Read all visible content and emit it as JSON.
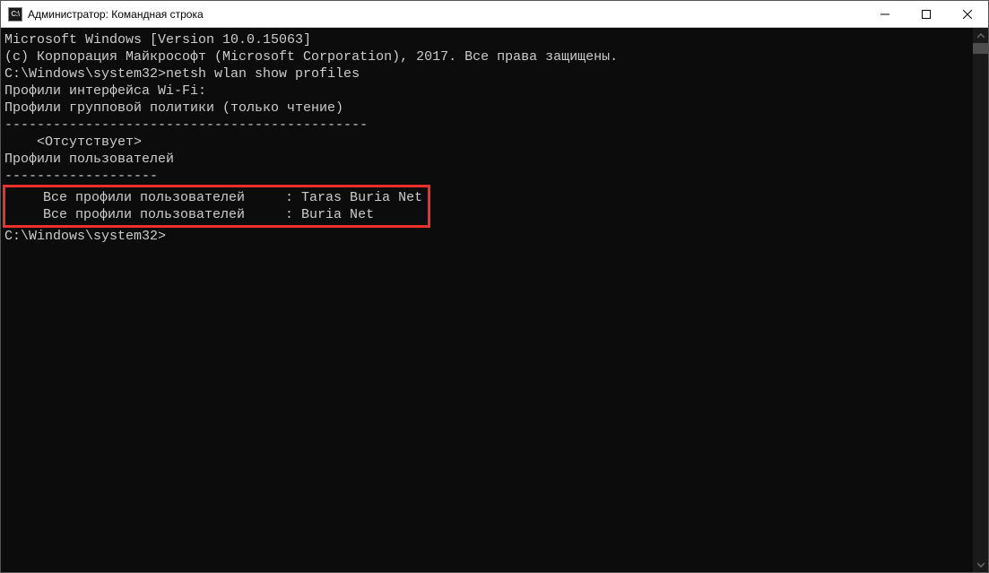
{
  "window": {
    "title": "Администратор: Командная строка"
  },
  "terminal": {
    "line1": "Microsoft Windows [Version 10.0.15063]",
    "line2": "(c) Корпорация Майкрософт (Microsoft Corporation), 2017. Все права защищены.",
    "blank": "",
    "prompt1": "C:\\Windows\\system32>netsh wlan show profiles",
    "blank2": "",
    "header": "Профили интерфейса Wi-Fi:",
    "blank3": "",
    "group_header": "Профили групповой политики (только чтение)",
    "group_sep": "---------------------------------------------",
    "group_none": "    <Отсутствует>",
    "blank4": "",
    "user_header": "Профили пользователей",
    "user_sep": "-------------------",
    "profile1": "    Все профили пользователей     : Taras Buria Net",
    "profile2": "    Все профили пользователей     : Buria Net",
    "box_pad": "                                                   ",
    "blank5": "",
    "blank6": "",
    "prompt2": "C:\\Windows\\system32>"
  }
}
